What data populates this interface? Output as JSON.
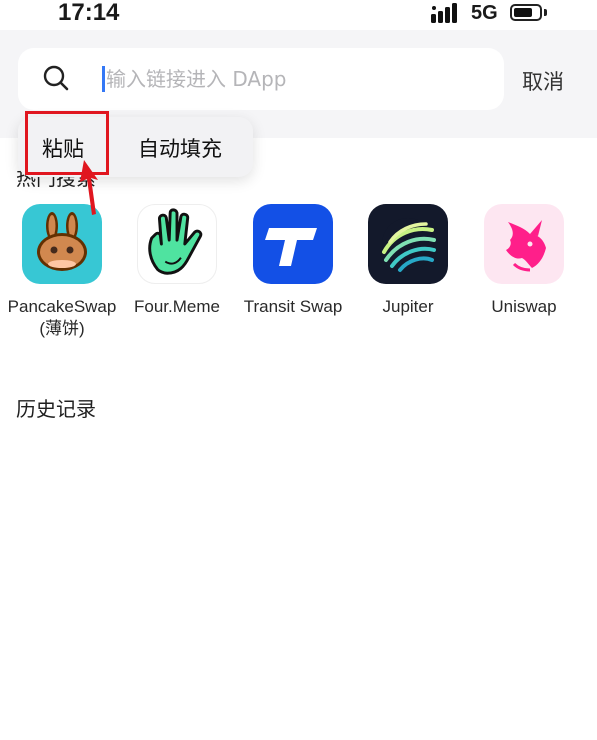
{
  "status_bar": {
    "time": "17:14",
    "network": "5G"
  },
  "search": {
    "placeholder": "输入链接进入 DApp",
    "value": "",
    "cancel_label": "取消"
  },
  "context_menu": {
    "paste_label": "粘贴",
    "autofill_label": "自动填充"
  },
  "hot": {
    "title": "热门搜索",
    "items": [
      {
        "label": "PancakeSwap(薄饼)",
        "icon": "pancakeswap-bunny-icon"
      },
      {
        "label": "Four.Meme",
        "icon": "waving-hand-icon"
      },
      {
        "label": "Transit Swap",
        "icon": "transit-t-icon"
      },
      {
        "label": "Jupiter",
        "icon": "jupiter-planet-icon"
      },
      {
        "label": "Uniswap",
        "icon": "uniswap-unicorn-icon"
      }
    ]
  },
  "history": {
    "title": "历史记录"
  },
  "colors": {
    "accent": "#3478f6",
    "highlight": "#e0161f",
    "header_bg": "#f5f5f7",
    "pancake_bg": "#37c7d4",
    "transit_bg": "#1350e6",
    "jupiter_bg": "#13192b",
    "uniswap_bg": "#fde6f1"
  }
}
